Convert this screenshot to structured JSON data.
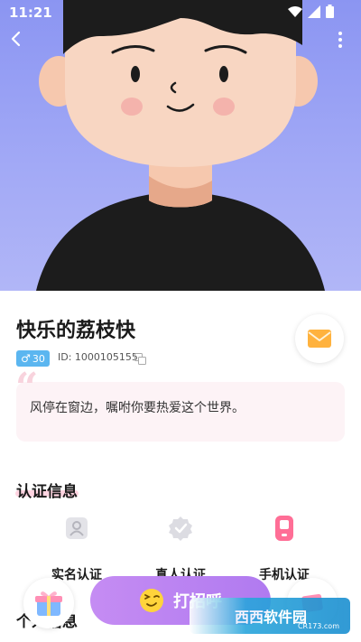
{
  "status_bar": {
    "time": "11:21"
  },
  "profile": {
    "nickname": "快乐的荔枝快",
    "gender_symbol": "♂",
    "age": "30",
    "id_text": "ID: 1000105155",
    "signature": "风停在窗边，嘱咐你要热爱这个世界。"
  },
  "certification": {
    "title": "认证信息",
    "items": [
      {
        "label": "实名认证",
        "icon": "id-card-icon"
      },
      {
        "label": "真人认证",
        "icon": "verified-badge-icon"
      },
      {
        "label": "手机认证",
        "icon": "phone-icon"
      }
    ]
  },
  "personal_section": {
    "title": "个人信息"
  },
  "actions": {
    "call_label": "打招呼"
  },
  "watermark": {
    "text": "西西软件园",
    "sub": "CR173.com"
  },
  "colors": {
    "hero_bg": "#9aa2f4",
    "accent_purple": "#b884f1",
    "pink_highlight": "#ffc9d9",
    "gender_badge": "#5bb6f0",
    "phone_icon": "#ff6e96"
  }
}
